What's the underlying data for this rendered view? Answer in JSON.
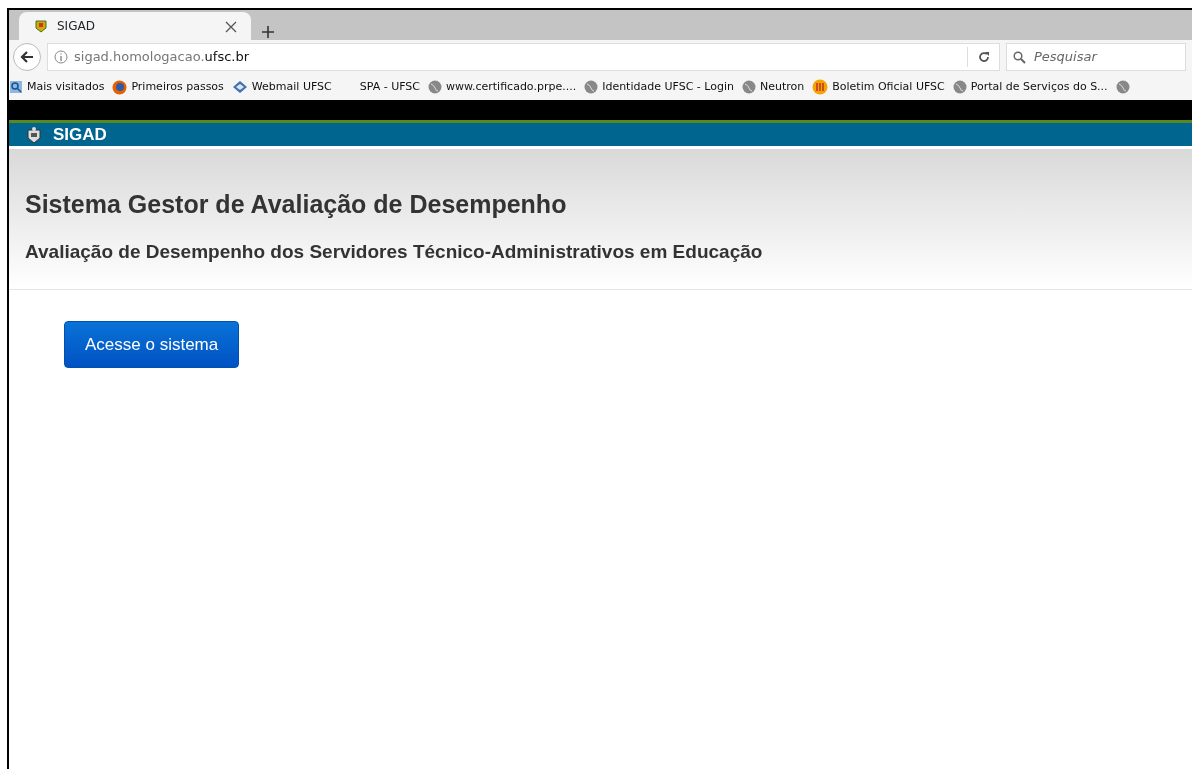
{
  "browser": {
    "tab": {
      "title": "SIGAD",
      "selected": true
    },
    "address": {
      "host": "sigad.homologacao.",
      "domain": "ufsc.br"
    },
    "search": {
      "placeholder": "Pesquisar"
    },
    "bookmarks": [
      {
        "label": "Mais visitados",
        "kind": "search"
      },
      {
        "label": "Primeiros passos",
        "kind": "firefox"
      },
      {
        "label": "Webmail UFSC",
        "kind": "mail"
      },
      {
        "label": "SPA - UFSC",
        "kind": "plain"
      },
      {
        "label": "www.certificado.prpe....",
        "kind": "globe"
      },
      {
        "label": "Identidade UFSC - Login",
        "kind": "globe"
      },
      {
        "label": "Neutron",
        "kind": "globe"
      },
      {
        "label": "Boletim Oficial UFSC",
        "kind": "badge"
      },
      {
        "label": "Portal de Serviços do S...",
        "kind": "globe"
      },
      {
        "kind": "globe"
      }
    ]
  },
  "header": {
    "title": "SIGAD"
  },
  "page": {
    "title": "Sistema Gestor de Avaliação de Desempenho",
    "subtitle": "Avaliação de Desempenho dos Servidores Técnico-Administrativos em Educação",
    "button": "Acesse o sistema"
  }
}
